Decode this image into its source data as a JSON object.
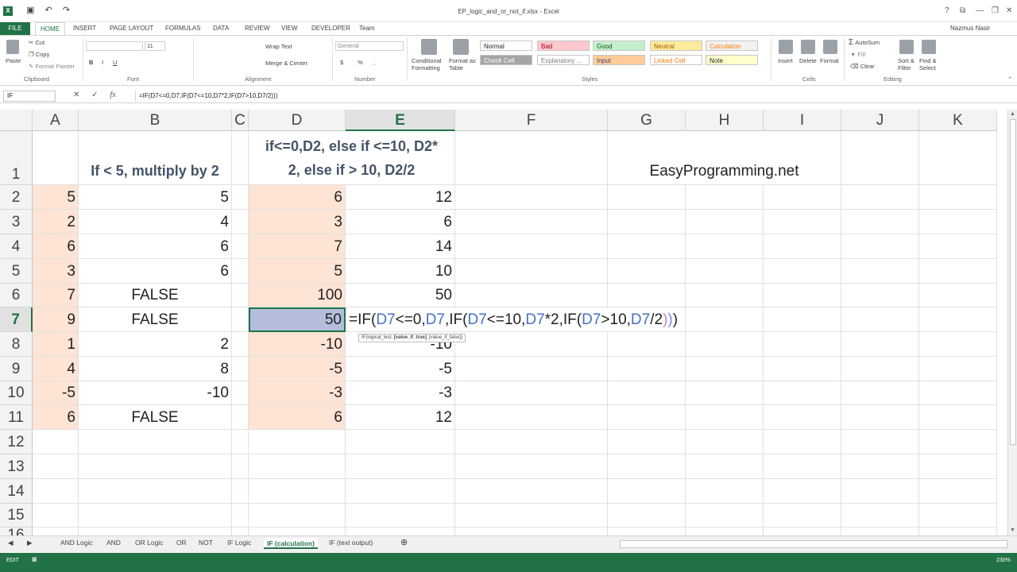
{
  "window": {
    "title": "EP_logic_and_or_not_if.xlsx - Excel",
    "user": "Nazmus Nasir",
    "help": "?",
    "restore": "⧉",
    "minimize": "—",
    "maximize": "❐",
    "close": "✕"
  },
  "ribbon_tabs": [
    "FILE",
    "HOME",
    "INSERT",
    "PAGE LAYOUT",
    "FORMULAS",
    "DATA",
    "REVIEW",
    "VIEW",
    "DEVELOPER",
    "Team"
  ],
  "ribbon": {
    "clipboard": {
      "paste": "Paste",
      "cut": "Cut",
      "copy": "Copy",
      "format_painter": "Format Painter",
      "group": "Clipboard"
    },
    "font": {
      "name": "",
      "size": "11",
      "bold": "B",
      "italic": "I",
      "underline": "U",
      "group": "Font"
    },
    "alignment": {
      "wrap": "Wrap Text",
      "merge": "Merge & Center",
      "group": "Alignment"
    },
    "number": {
      "format": "General",
      "currency": "$",
      "percent": "%",
      "comma": ",",
      "group": "Number"
    },
    "styles": {
      "conditional": "Conditional",
      "formatting": "Formatting",
      "format_as": "Format as",
      "table": "Table",
      "group": "Styles",
      "cells": [
        {
          "label": "Normal",
          "bg": "#ffffff",
          "fg": "#222222"
        },
        {
          "label": "Bad",
          "bg": "#ffc7ce",
          "fg": "#9c0006"
        },
        {
          "label": "Good",
          "bg": "#c6efce",
          "fg": "#006100"
        },
        {
          "label": "Neutral",
          "bg": "#ffeb9c",
          "fg": "#9c5700"
        },
        {
          "label": "Calculation",
          "bg": "#f2f2f2",
          "fg": "#fa7d00"
        },
        {
          "label": "Check Cell",
          "bg": "#a5a5a5",
          "fg": "#ffffff"
        },
        {
          "label": "Explanatory ...",
          "bg": "#ffffff",
          "fg": "#7f7f7f"
        },
        {
          "label": "Input",
          "bg": "#ffcc99",
          "fg": "#3f3f76"
        },
        {
          "label": "Linked Cell",
          "bg": "#ffffff",
          "fg": "#fa7d00"
        },
        {
          "label": "Note",
          "bg": "#ffffcc",
          "fg": "#222222"
        }
      ]
    },
    "cells": {
      "insert": "Insert",
      "delete": "Delete",
      "format": "Format",
      "group": "Cells"
    },
    "editing": {
      "autosum": "AutoSum",
      "fill": "Fill",
      "clear": "Clear",
      "sort": "Sort &",
      "filter": "Filter",
      "find": "Find &",
      "select": "Select",
      "group": "Editing"
    }
  },
  "formula_bar": {
    "name_box": "IF",
    "cancel": "✕",
    "enter": "✓",
    "fx": "fx",
    "formula": "=IF(D7<=0,D7,IF(D7<=10,D7*2,IF(D7>10,D7/2)))"
  },
  "columns": [
    "A",
    "B",
    "C",
    "D",
    "E",
    "F",
    "G",
    "H",
    "I",
    "J",
    "K"
  ],
  "rows": [
    "1",
    "2",
    "3",
    "4",
    "5",
    "6",
    "7",
    "8",
    "9",
    "10",
    "11",
    "12",
    "13",
    "14",
    "15",
    "16"
  ],
  "sheet": {
    "b1": "If < 5, multiply by 2",
    "d1_line1": "if<=0,D2, else if <=10, D2*",
    "d1_line2": "2, else if > 10, D2/2",
    "g1": "EasyProgramming.net",
    "a": [
      "5",
      "2",
      "6",
      "3",
      "7",
      "9",
      "1",
      "4",
      "-5",
      "6"
    ],
    "b": [
      "5",
      "4",
      "6",
      "6",
      "FALSE",
      "FALSE",
      "2",
      "8",
      "-10",
      "FALSE"
    ],
    "d": [
      "6",
      "3",
      "7",
      "5",
      "100",
      "50",
      "-10",
      "-5",
      "-3",
      "6"
    ],
    "e": [
      "12",
      "6",
      "14",
      "10",
      "50",
      "",
      "-10",
      "-5",
      "-3",
      "12"
    ]
  },
  "edit": {
    "p1": "=IF(",
    "r1": "D7",
    "p2": "<=0,",
    "r2": "D7",
    "p3": ",IF(",
    "r3": "D7",
    "p4": "<=10,",
    "r4": "D7",
    "p5": "*2,IF(",
    "r5": "D7",
    "p6": ">10,",
    "r6": "D7",
    "p7": "/2",
    "c3": ")",
    "c2": ")",
    "c1": ")"
  },
  "tooltip": {
    "a": "IF(logical_test, ",
    "b": "[value_if_true]",
    "c": ", [value_if_false])"
  },
  "sheet_tabs": [
    "AND Logic",
    "AND",
    "OR Logic",
    "OR",
    "NOT",
    "IF Logic",
    "IF (calculation)",
    "IF (text output)"
  ],
  "active_sheet": "IF (calculation)",
  "status": {
    "mode": "EDIT",
    "zoom": "230%"
  }
}
